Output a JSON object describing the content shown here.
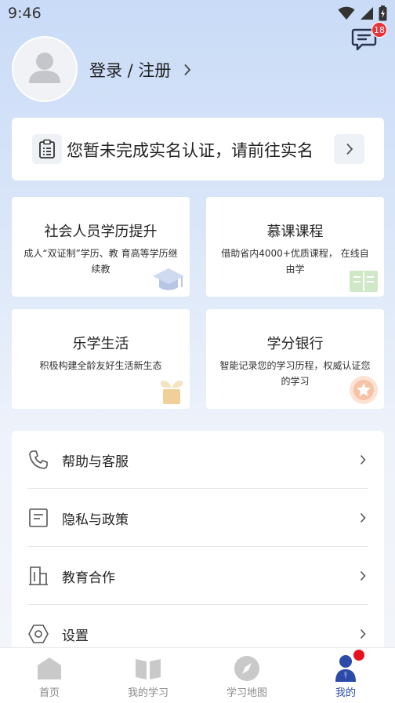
{
  "status_bar": {
    "time": "9:46"
  },
  "header": {
    "message_badge": "18",
    "login_label": "登录 / 注册"
  },
  "verify_card": {
    "text": "您暂未完成实名认证，请前往实名"
  },
  "features": [
    {
      "title": "社会人员学历提升",
      "desc": "成人“双证制”学历、教 育高等学历继续教",
      "icon": "graduation-cap-icon"
    },
    {
      "title": "慕课课程",
      "desc": "借助省内4000+优质课程， 在线自由学",
      "icon": "open-book-icon"
    },
    {
      "title": "乐学生活",
      "desc": "积极构建全龄友好生活新生态",
      "icon": "sprout-pot-icon"
    },
    {
      "title": "学分银行",
      "desc": "智能记录您的学习历程，权威认证您的学习",
      "icon": "star-medal-icon"
    }
  ],
  "menu": [
    {
      "label": "帮助与客服",
      "icon": "phone-icon"
    },
    {
      "label": "隐私与政策",
      "icon": "document-icon"
    },
    {
      "label": "教育合作",
      "icon": "building-icon"
    },
    {
      "label": "设置",
      "icon": "settings-hexagon-icon"
    }
  ],
  "tabs": [
    {
      "label": "首页",
      "icon": "home-icon",
      "active": false
    },
    {
      "label": "我的学习",
      "icon": "book-icon",
      "active": false
    },
    {
      "label": "学习地图",
      "icon": "compass-icon",
      "active": false
    },
    {
      "label": "我的",
      "icon": "person-icon",
      "active": true
    }
  ],
  "colors": {
    "accent": "#2c4aa8",
    "badge": "#e8333a",
    "page_bg": "#dbe7f8"
  }
}
